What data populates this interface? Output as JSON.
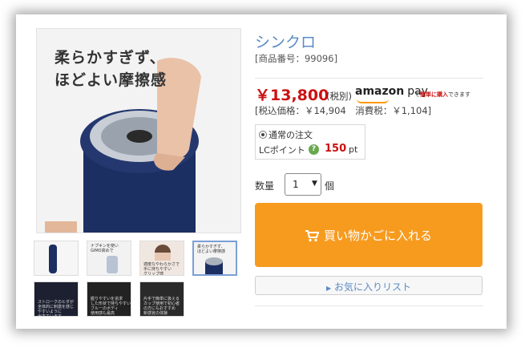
{
  "main_image": {
    "caption_line1": "柔らかすぎず、",
    "caption_line2": "ほどよい摩擦感"
  },
  "thumbnails": [
    {
      "text": ""
    },
    {
      "text": "ナプキンを使い\nGIMO高めで"
    },
    {
      "text": "適度なやわらかさで\n手に持ちやすい\nグリップ感"
    },
    {
      "text": "柔らかすぎず、\nほどよい摩擦感"
    },
    {
      "text": "ストロークのヒダが\n全体的に刺激を感じ\nやすいように\n出来ています"
    },
    {
      "text": "握りやすいを追求\nした形状で持ちやすい\nブルーのボディ\n使用感も最高"
    },
    {
      "text": "片手で簡単に扱える\nカップ使用で初心者\nの方にもおすすめ\n新感覚の体験"
    }
  ],
  "product": {
    "title": "シンクロ",
    "sku": "[商品番号：99096]",
    "price": "￥13,800",
    "tax_label": "(税別)",
    "tax_detail": "[税込価格：￥14,904　消費税：￥1,104]"
  },
  "amazon_pay": {
    "brand": "amazon",
    "pay": "pay",
    "note_prefix": "で",
    "note_emphasis": "簡単に購入",
    "note_suffix": "できます"
  },
  "order": {
    "type_label": "通常の注文",
    "lc_label": "LCポイント",
    "lc_points": "150",
    "lc_unit": "pt"
  },
  "quantity": {
    "label": "数量",
    "value": "1",
    "unit": "個"
  },
  "buttons": {
    "cart": "買い物かごに入れる",
    "wishlist": "お気に入りリスト"
  },
  "colors": {
    "accent_orange": "#f79b1f",
    "price_red": "#cc1111",
    "link_blue": "#5b8bc6"
  }
}
